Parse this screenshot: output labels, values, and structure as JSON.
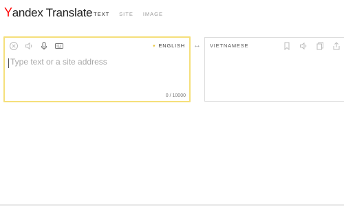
{
  "logo": {
    "first_letter": "Y",
    "rest": "andex Translate"
  },
  "nav": {
    "tabs": [
      {
        "label": "TEXT",
        "active": true
      },
      {
        "label": "SITE",
        "active": false
      },
      {
        "label": "IMAGE",
        "active": false
      }
    ]
  },
  "source": {
    "language": "ENGLISH",
    "placeholder": "Type text or a site address",
    "value": "",
    "counter": "0 / 10000",
    "toolbar_icons": [
      "clear-icon",
      "speaker-icon",
      "microphone-icon",
      "keyboard-icon"
    ]
  },
  "swap_icon": "↔",
  "target": {
    "language": "VIETNAMESE",
    "toolbar_icons": [
      "bookmark-icon",
      "speaker-icon",
      "copy-icon",
      "share-icon"
    ]
  },
  "colors": {
    "accent_border": "#f5df7a",
    "logo_red": "#ff0000",
    "panel_border": "#dcdcdc"
  }
}
